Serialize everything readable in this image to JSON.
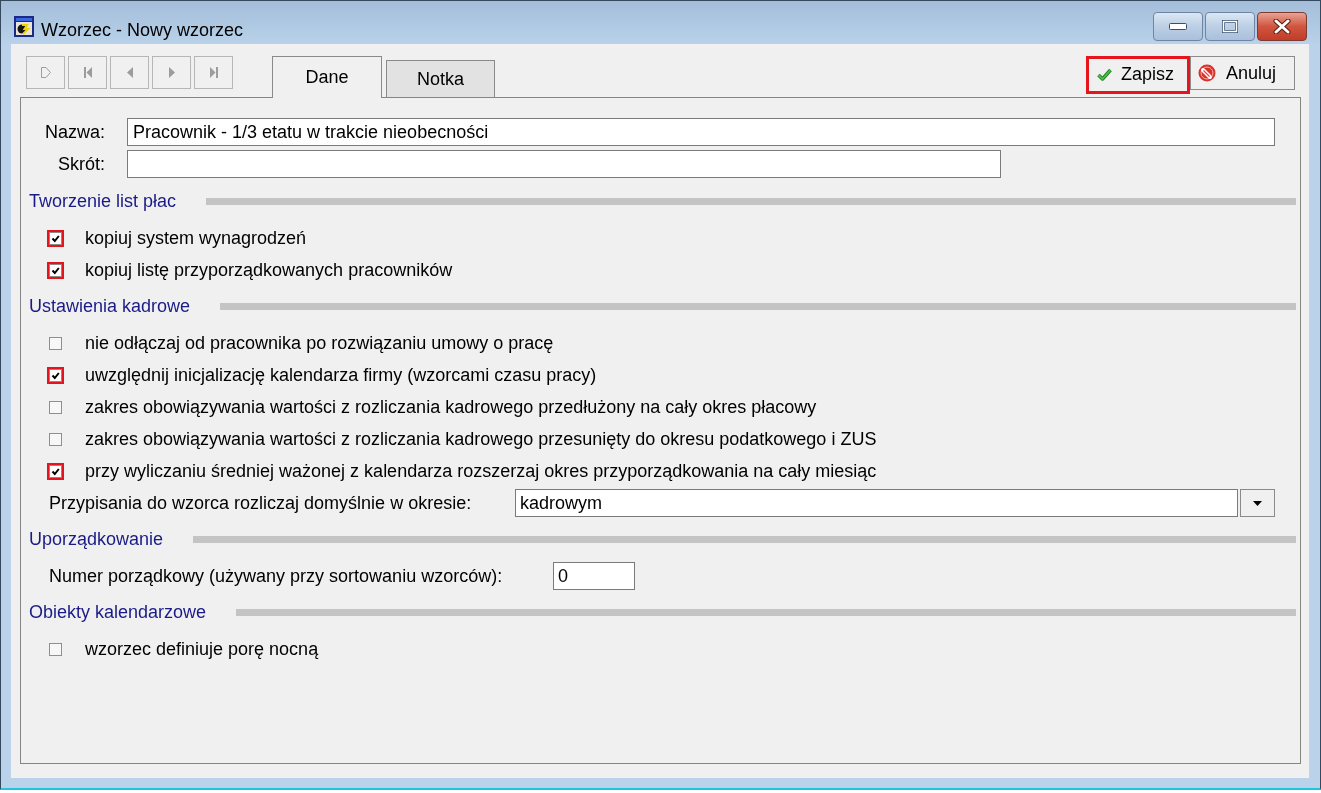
{
  "window": {
    "title": "Wzorzec - Nowy wzorzec"
  },
  "record_nav": [
    {
      "kind": "new",
      "disabled": true
    },
    {
      "kind": "first",
      "disabled": true
    },
    {
      "kind": "previous",
      "disabled": true
    },
    {
      "kind": "next",
      "disabled": true
    },
    {
      "kind": "last",
      "disabled": true
    }
  ],
  "tabs": [
    {
      "label": "Dane",
      "selected": true
    },
    {
      "label": "Notka",
      "selected": false
    }
  ],
  "actions": [
    {
      "kind": "save",
      "label": "Zapisz",
      "highlighted": true
    },
    {
      "kind": "cancel",
      "label": "Anuluj",
      "highlighted": false
    }
  ],
  "fields": [
    {
      "label": "Nazwa:",
      "value": "Pracownik - 1/3 etatu w trakcie nieobecności"
    },
    {
      "label": "Skrót:"
    }
  ],
  "sections": [
    {
      "title": "Tworzenie list płac",
      "items": [
        {
          "kind": "checkbox",
          "label": "kopiuj system wynagrodzeń",
          "checked": true
        },
        {
          "kind": "checkbox",
          "label": "kopiuj listę przyporządkowanych pracowników",
          "checked": true
        }
      ]
    },
    {
      "title": "Ustawienia kadrowe",
      "items": [
        {
          "kind": "checkbox",
          "label": "nie odłączaj od pracownika po rozwiązaniu umowy o pracę",
          "checked": false
        },
        {
          "kind": "checkbox",
          "label": "uwzględnij inicjalizację kalendarza firmy (wzorcami czasu pracy)",
          "checked": true
        },
        {
          "kind": "checkbox",
          "label": "zakres obowiązywania wartości z rozliczania kadrowego przedłużony na cały okres płacowy",
          "checked": false
        },
        {
          "kind": "checkbox",
          "label": "zakres obowiązywania wartości z rozliczania kadrowego przesunięty do okresu podatkowego i ZUS",
          "checked": false
        },
        {
          "kind": "checkbox",
          "label": "przy wyliczaniu średniej ważonej z kalendarza rozszerzaj okres przyporządkowania na cały miesiąc",
          "checked": true
        },
        {
          "kind": "dropdown",
          "label": "Przypisania do wzorca rozliczaj domyślnie w okresie:",
          "value": "kadrowym"
        }
      ]
    },
    {
      "title": "Uporządkowanie",
      "items": [
        {
          "kind": "number",
          "label": "Numer porządkowy (używany przy sortowaniu wzorców):",
          "value": "0"
        }
      ]
    },
    {
      "title": "Obiekty kalendarzowe",
      "items": [
        {
          "kind": "checkbox",
          "label": "wzorzec definiuje porę nocną",
          "checked": false
        }
      ]
    }
  ]
}
